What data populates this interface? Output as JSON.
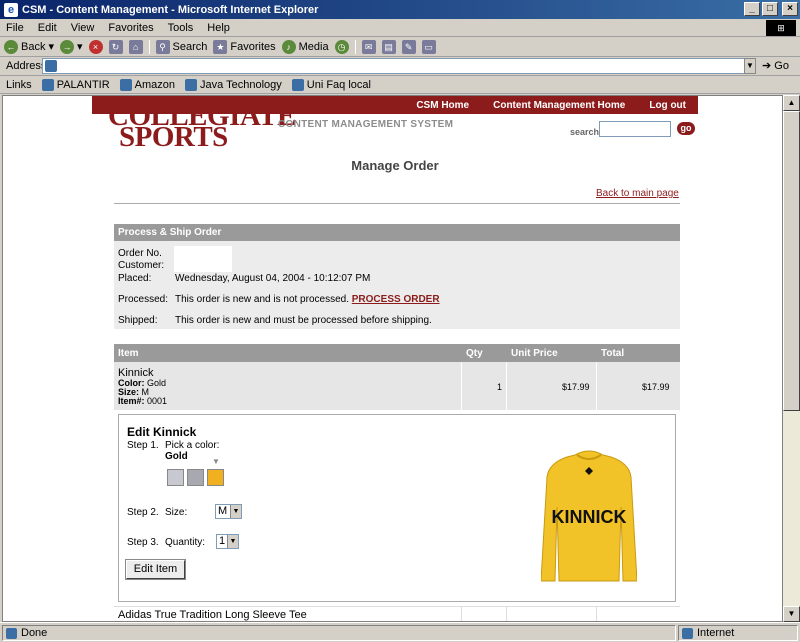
{
  "window": {
    "title": "CSM - Content Management - Microsoft Internet Explorer"
  },
  "menu": [
    "File",
    "Edit",
    "View",
    "Favorites",
    "Tools",
    "Help"
  ],
  "toolbar": {
    "back": "Back",
    "search": "Search",
    "favorites": "Favorites",
    "media": "Media"
  },
  "address": {
    "label": "Address",
    "go": "Go"
  },
  "links": {
    "label": "Links",
    "items": [
      "PALANTIR",
      "Amazon",
      "Java Technology",
      "Uni Faq local"
    ]
  },
  "status": {
    "left": "Done",
    "right": "Internet"
  },
  "nav": {
    "items": [
      "CSM Home",
      "Content Management Home",
      "Log out"
    ]
  },
  "brand": {
    "line1": "COLLEGIATE",
    "line2": "SPORTS",
    "subtitle": "CONTENT MANAGEMENT SYSTEM"
  },
  "search": {
    "label": "search",
    "go": "go"
  },
  "page": {
    "title": "Manage Order",
    "back_link": "Back to main page"
  },
  "process": {
    "header": "Process & Ship Order",
    "order_no_label": "Order No.",
    "customer_label": "Customer:",
    "placed_label": "Placed:",
    "placed_value": "Wednesday, August 04, 2004 - 10:12:07 PM",
    "processed_label": "Processed:",
    "processed_text": "This order is new and is not processed.",
    "process_link": "PROCESS ORDER",
    "shipped_label": "Shipped:",
    "shipped_text": "This order is new and must be processed before shipping."
  },
  "table": {
    "headers": {
      "item": "Item",
      "qty": "Qty",
      "unit_price": "Unit Price",
      "total": "Total"
    },
    "row1": {
      "name": "Kinnick",
      "color_label": "Color:",
      "color": "Gold",
      "size_label": "Size:",
      "size": "M",
      "item_label": "Item#:",
      "item_no": "0001",
      "qty": "1",
      "unit_price": "$17.99",
      "total": "$17.99"
    },
    "row2": {
      "name": "Adidas True Tradition Long Sleeve Tee"
    }
  },
  "edit": {
    "title": "Edit Kinnick",
    "step1": "Step 1.",
    "pick_color": "Pick a color:",
    "color_selected": "Gold",
    "swatch_colors": [
      "#c8c8d0",
      "#a8a8b0",
      "#f0b020"
    ],
    "step2": "Step 2.",
    "size_label": "Size:",
    "size_value": "M",
    "step3": "Step 3.",
    "qty_label": "Quantity:",
    "qty_value": "1",
    "button": "Edit Item",
    "shirt_text": "KINNICK"
  }
}
